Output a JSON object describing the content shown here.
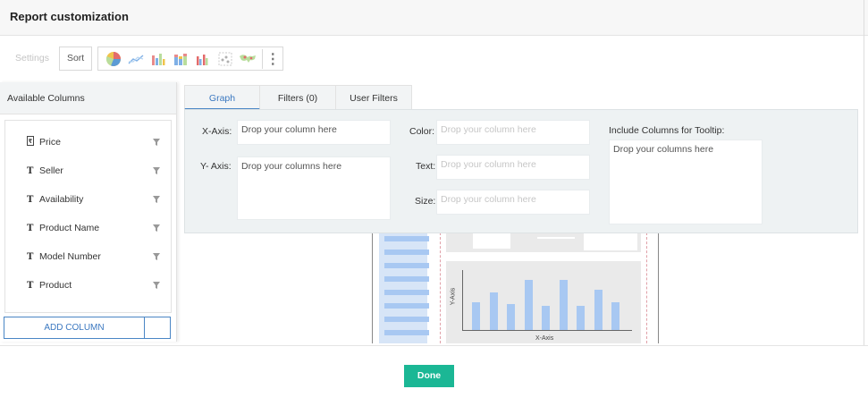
{
  "window": {
    "title": "Report customization"
  },
  "toolbar": {
    "settings_label": "Settings",
    "sort_label": "Sort",
    "chart_types": [
      "pie-chart-icon",
      "line-chart-icon",
      "bar-chart-icon",
      "stacked-bar-icon",
      "grouped-bar-icon",
      "scatter-chart-icon",
      "map-chart-icon"
    ]
  },
  "available_columns": {
    "title": "Available Columns",
    "items": [
      {
        "type": "₹",
        "name": "Price"
      },
      {
        "type": "T",
        "name": "Seller"
      },
      {
        "type": "T",
        "name": "Availability"
      },
      {
        "type": "T",
        "name": "Product Name"
      },
      {
        "type": "T",
        "name": "Model Number"
      },
      {
        "type": "T",
        "name": "Product"
      }
    ],
    "add_column_label": "ADD COLUMN"
  },
  "tabs": [
    {
      "label": "Graph",
      "active": true
    },
    {
      "label": "Filters (0)",
      "active": false
    },
    {
      "label": "User Filters",
      "active": false
    }
  ],
  "graph_config": {
    "x_axis": {
      "label": "X-Axis:",
      "placeholder": "Drop your column here"
    },
    "y_axis": {
      "label": "Y- Axis:",
      "placeholder": "Drop your columns here"
    },
    "color": {
      "label": "Color:",
      "placeholder": "Drop your column here"
    },
    "text": {
      "label": "Text:",
      "placeholder": "Drop your column here"
    },
    "size": {
      "label": "Size:",
      "placeholder": "Drop your column here"
    },
    "tooltip": {
      "label": "Include Columns for Tooltip:",
      "placeholder": "Drop your columns here"
    }
  },
  "preview": {
    "y_axis_label": "Y-Axis",
    "x_axis_label": "X-Axis",
    "bars": [
      0.45,
      0.62,
      0.42,
      0.82,
      0.4,
      0.82,
      0.4,
      0.66,
      0.46
    ]
  },
  "footer": {
    "done_label": "Done"
  },
  "colors": {
    "accent": "#4a86c5",
    "done": "#1bb795",
    "preview_bar": "#a8c8f2"
  }
}
